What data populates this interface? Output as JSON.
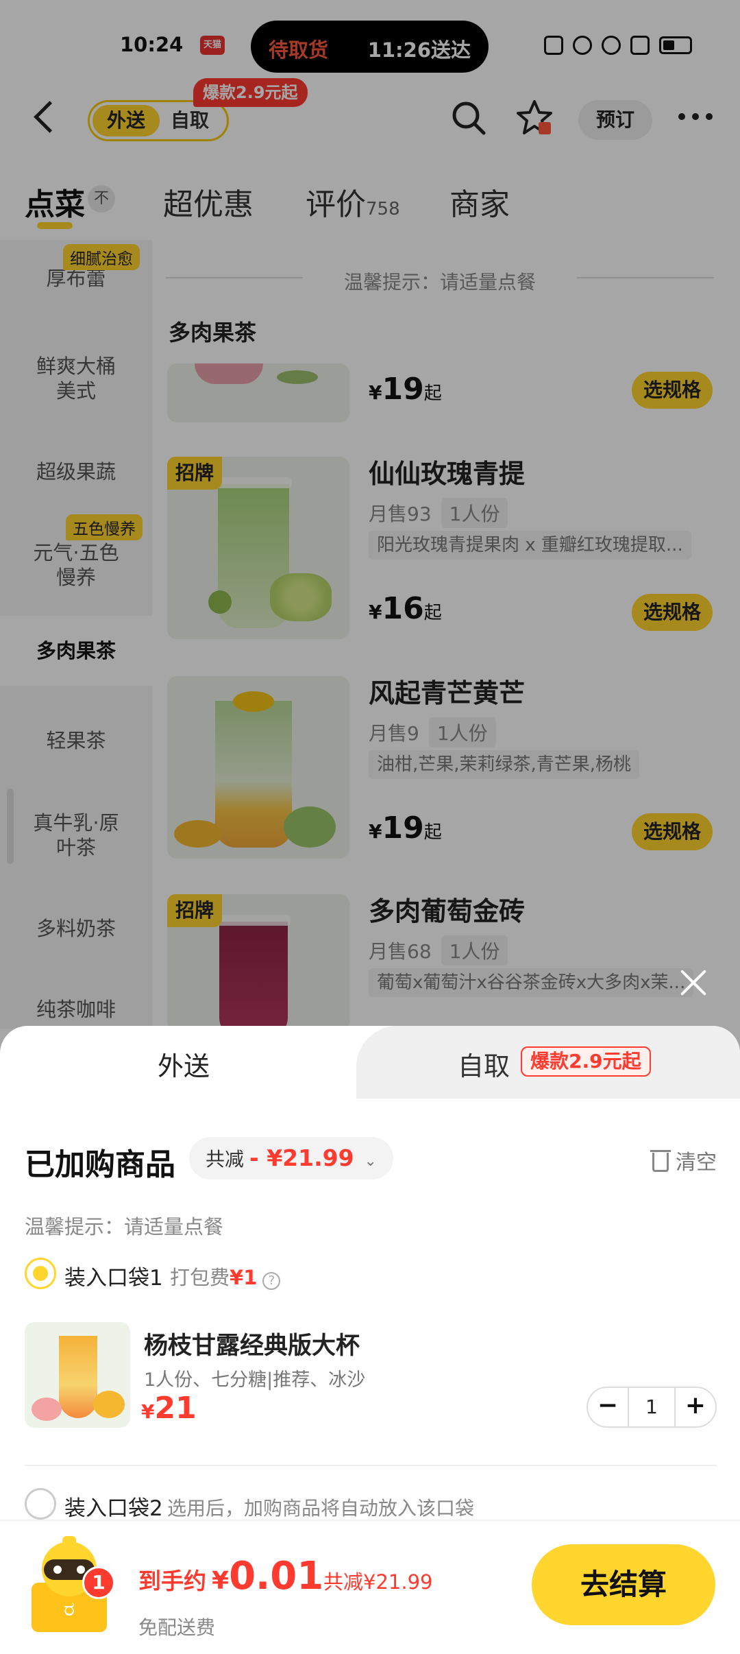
{
  "status_bar": {
    "time": "10:24",
    "app_badge": "天猫",
    "pill_left": "待取货",
    "pill_right": "11:26送达"
  },
  "nav": {
    "mode_delivery": "外送",
    "mode_pickup": "自取",
    "hot_badge": "爆款2.9元起",
    "reserve": "预订"
  },
  "tabs": [
    {
      "label": "点菜",
      "active": true
    },
    {
      "label": "超优惠"
    },
    {
      "label": "评价",
      "count": "758"
    },
    {
      "label": "商家"
    }
  ],
  "sort_icon_label": "不",
  "sidebar": {
    "items": [
      {
        "label": "厚布蕾",
        "tag": "细腻治愈"
      },
      {
        "label": "鲜爽大桶美式"
      },
      {
        "label": "超级果蔬"
      },
      {
        "label": "元气·五色慢养",
        "tag": "五色慢养"
      },
      {
        "label": "多肉果茶",
        "active": true
      },
      {
        "label": "轻果茶"
      },
      {
        "label": "真牛乳·原叶茶"
      },
      {
        "label": "多料奶茶"
      },
      {
        "label": "纯茶咖啡"
      }
    ]
  },
  "content": {
    "tip": "温馨提示：请适量点餐",
    "section_title": "多肉果茶",
    "products": [
      {
        "name": "",
        "price": "19",
        "price_suffix": "起",
        "spec_btn": "选规格"
      },
      {
        "badge": "招牌",
        "name": "仙仙玫瑰青提",
        "sales": "月售93",
        "serving": "1人份",
        "desc": "阳光玫瑰青提果肉 x 重瓣红玫瑰提取...",
        "price": "16",
        "price_suffix": "起",
        "spec_btn": "选规格"
      },
      {
        "name": "风起青芒黄芒",
        "sales": "月售9",
        "serving": "1人份",
        "desc": "油柑,芒果,茉莉绿茶,青芒果,杨桃",
        "price": "19",
        "price_suffix": "起",
        "spec_btn": "选规格"
      },
      {
        "badge": "招牌",
        "name": "多肉葡萄金砖",
        "sales": "月售68",
        "serving": "1人份",
        "desc": "葡萄x葡萄汁x谷谷茶金砖x大多肉x茉..."
      }
    ]
  },
  "sheet": {
    "tab_delivery": "外送",
    "tab_pickup": "自取",
    "tab_pickup_badge": "爆款2.9元起",
    "title": "已加购商品",
    "discount_label": "共减",
    "discount_amount": "- ¥21.99",
    "clear": "清空",
    "tip": "温馨提示：请适量点餐",
    "bag1": {
      "label": "装入口袋1",
      "fee_label": "打包费",
      "fee": "¥1"
    },
    "item": {
      "name": "杨枝甘露经典版大杯",
      "spec": "1人份、七分糖|推荐、冰沙",
      "yen": "¥",
      "price": "21",
      "qty": "1"
    },
    "bag2": {
      "label": "装入口袋2",
      "note": "选用后，加购商品将自动放入该口袋"
    }
  },
  "footer": {
    "cart_count": "1",
    "total_label": "到手约",
    "yen": "¥",
    "total": "0.01",
    "saved": "共减¥21.99",
    "delivery": "免配送费",
    "checkout": "去结算"
  },
  "colors": {
    "brand_yellow": "#ffd52e",
    "accent_red": "#ff3b30"
  }
}
